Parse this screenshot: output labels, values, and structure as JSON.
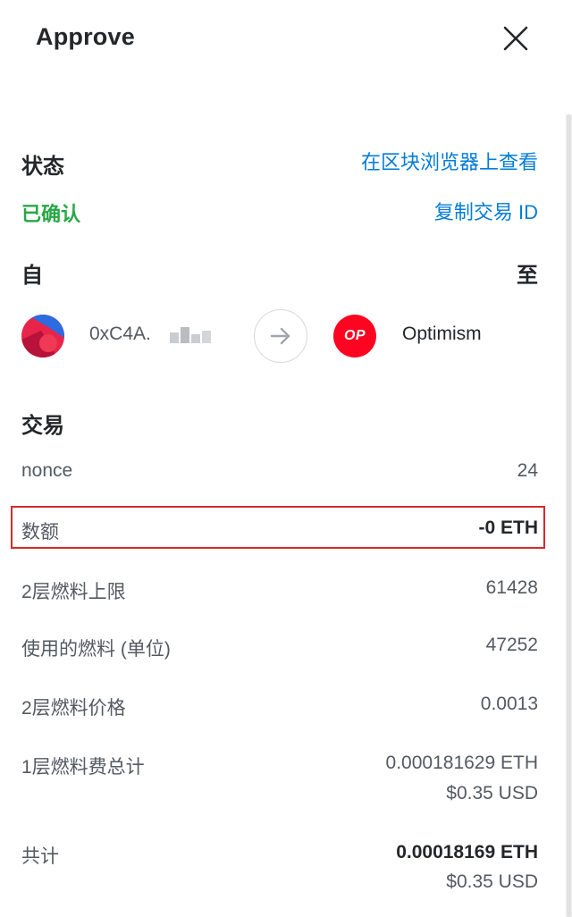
{
  "header": {
    "title": "Approve"
  },
  "status": {
    "label": "状态",
    "value": "已确认",
    "explorer_link": "在区块浏览器上查看",
    "copy_link": "复制交易 ID"
  },
  "from_to": {
    "from_label": "自",
    "to_label": "至",
    "from_address": "0xC4A.",
    "network": "Optimism",
    "network_logo_text": "OP"
  },
  "transaction": {
    "title": "交易",
    "rows": [
      {
        "label": "nonce",
        "value": "24"
      },
      {
        "label": "数额",
        "value": "-0 ETH"
      },
      {
        "label": "2层燃料上限",
        "value": "61428"
      },
      {
        "label": "使用的燃料 (单位)",
        "value": "47252"
      },
      {
        "label": "2层燃料价格",
        "value": "0.0013"
      },
      {
        "label": "1层燃料费总计",
        "value": "0.000181629 ETH",
        "sub_value": "$0.35 USD"
      },
      {
        "label": "共计",
        "value": "0.00018169 ETH",
        "sub_value": "$0.35 USD"
      }
    ]
  },
  "colors": {
    "link": "#037dd6",
    "confirmed": "#28a745",
    "network_brand": "#ff0420",
    "highlight_border": "#d62b2b"
  }
}
